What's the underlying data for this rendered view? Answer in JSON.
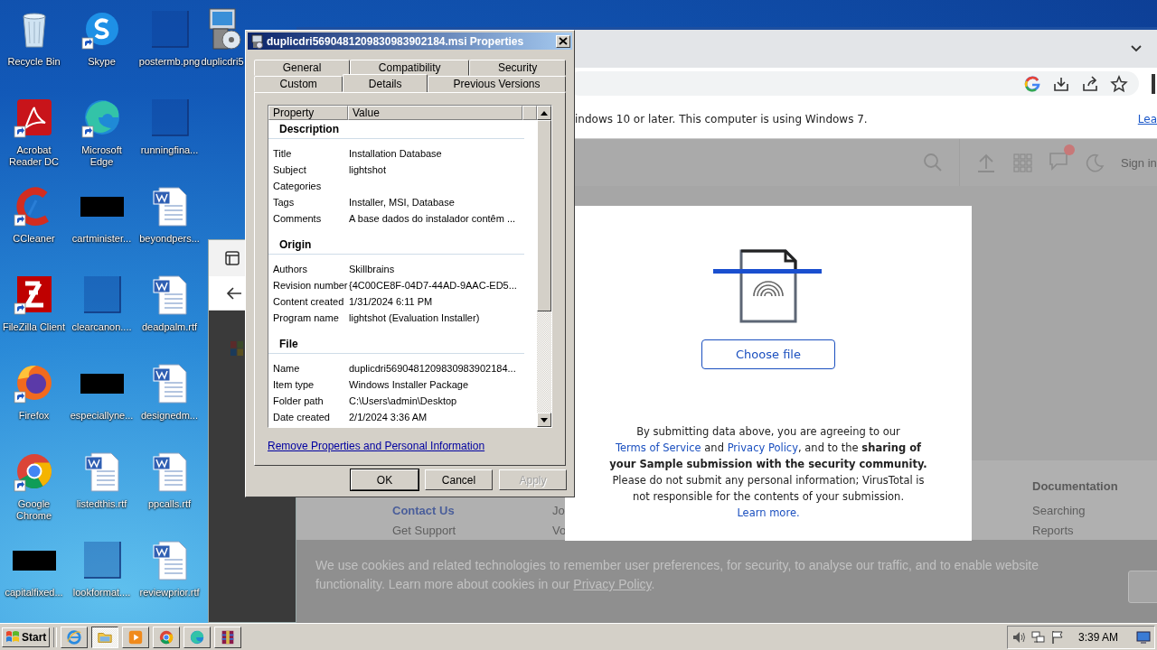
{
  "desktop_icons": [
    {
      "label": "Recycle Bin",
      "kind": "recycle",
      "shortcut": false
    },
    {
      "label": "Acrobat Reader DC",
      "kind": "acrobat",
      "shortcut": true
    },
    {
      "label": "CCleaner",
      "kind": "ccleaner",
      "shortcut": true
    },
    {
      "label": "FileZilla Client",
      "kind": "filezilla",
      "shortcut": true
    },
    {
      "label": "Firefox",
      "kind": "firefox",
      "shortcut": true
    },
    {
      "label": "Google Chrome",
      "kind": "chrome",
      "shortcut": true
    },
    {
      "label": "capitalfixed...",
      "kind": "redacted",
      "shortcut": false
    },
    {
      "label": "Skype",
      "kind": "skype",
      "shortcut": true
    },
    {
      "label": "Microsoft Edge",
      "kind": "edge",
      "shortcut": true
    },
    {
      "label": "cartminister...",
      "kind": "redacted",
      "shortcut": false
    },
    {
      "label": "clearcanon....",
      "kind": "blank",
      "shortcut": false
    },
    {
      "label": "especiallyne...",
      "kind": "redacted",
      "shortcut": false
    },
    {
      "label": "listedthis.rtf",
      "kind": "word",
      "shortcut": false
    },
    {
      "label": "lookformat....",
      "kind": "blank",
      "shortcut": false
    },
    {
      "label": "postermb.png",
      "kind": "blank",
      "shortcut": false
    },
    {
      "label": "runningfina...",
      "kind": "blank",
      "shortcut": false
    },
    {
      "label": "beyondpers...",
      "kind": "word",
      "shortcut": false
    },
    {
      "label": "deadpalm.rtf",
      "kind": "word",
      "shortcut": false
    },
    {
      "label": "designedm...",
      "kind": "word",
      "shortcut": false
    },
    {
      "label": "ppcalls.rtf",
      "kind": "word",
      "shortcut": false
    },
    {
      "label": "reviewprior.rtf",
      "kind": "word",
      "shortcut": false
    },
    {
      "label": "duplicdri5",
      "kind": "installer",
      "shortcut": false
    }
  ],
  "browser": {
    "info_bar": {
      "message": "indows 10 or later. This computer is using Windows 7.",
      "link": "Lea"
    },
    "site_header": {
      "sign_in": "Sign in"
    },
    "footer": [
      {
        "links": [
          {
            "label": "Contact Us",
            "kind": "accent"
          },
          {
            "label": "Get Support",
            "kind": "plain"
          }
        ]
      },
      {
        "links": [
          {
            "label": "Jo",
            "kind": "plain"
          },
          {
            "label": "Vo",
            "kind": "plain"
          }
        ]
      },
      {
        "heading": "Documentation",
        "links": [
          {
            "label": "Searching",
            "kind": "plain"
          },
          {
            "label": "Reports",
            "kind": "plain"
          }
        ]
      }
    ],
    "modal": {
      "button": "Choose file",
      "notice": [
        {
          "kind": "text",
          "text": "By submitting data above, you are agreeing to our "
        },
        {
          "kind": "link",
          "text": "Terms of Service"
        },
        {
          "kind": "text",
          "text": " and "
        },
        {
          "kind": "link",
          "text": "Privacy Policy"
        },
        {
          "kind": "text",
          "text": ", and to the "
        },
        {
          "kind": "bold",
          "text": "sharing of your Sample submission with the security community."
        },
        {
          "kind": "text",
          "text": " Please do not submit any personal information; VirusTotal is not responsible for the contents of your submission. "
        },
        {
          "kind": "link",
          "text": "Learn more."
        }
      ]
    },
    "cookie_banner": [
      {
        "kind": "text",
        "text": "We use cookies and related technologies to remember user preferences, for security, to analyse our traffic, and to enable website functionality. Learn more about cookies in our "
      },
      {
        "kind": "link",
        "text": "Privacy Policy"
      },
      {
        "kind": "text",
        "text": "."
      }
    ]
  },
  "properties_dialog": {
    "title": "duplicdri5690481209830983902184.msi Properties",
    "tab_rows": [
      [
        {
          "label": "General",
          "selected": false
        },
        {
          "label": "Compatibility",
          "selected": false
        },
        {
          "label": "Security",
          "selected": false
        }
      ],
      [
        {
          "label": "Custom",
          "selected": false
        },
        {
          "label": "Details",
          "selected": true
        },
        {
          "label": "Previous Versions",
          "selected": false
        }
      ]
    ],
    "columns": [
      "Property",
      "Value"
    ],
    "groups": [
      {
        "heading": "Description",
        "rows": [
          {
            "property": "Title",
            "value": "Installation Database"
          },
          {
            "property": "Subject",
            "value": "lightshot"
          },
          {
            "property": "Categories"
          },
          {
            "property": "Tags",
            "value": "Installer, MSI, Database"
          },
          {
            "property": "Comments",
            "value": "A base dados do instalador contêm ..."
          }
        ]
      },
      {
        "heading": "Origin",
        "rows": [
          {
            "property": "Authors",
            "value": "Skillbrains"
          },
          {
            "property": "Revision number",
            "value": "{4C00CE8F-04D7-44AD-9AAC-ED5..."
          },
          {
            "property": "Content created",
            "value": "1/31/2024 6:11 PM"
          },
          {
            "property": "Program name",
            "value": "lightshot (Evaluation Installer)"
          }
        ]
      },
      {
        "heading": "File",
        "rows": [
          {
            "property": "Name",
            "value": "duplicdri5690481209830983902184..."
          },
          {
            "property": "Item type",
            "value": "Windows Installer Package"
          },
          {
            "property": "Folder path",
            "value": "C:\\Users\\admin\\Desktop"
          },
          {
            "property": "Date created",
            "value": "2/1/2024 3:36 AM"
          }
        ]
      }
    ],
    "link": "Remove Properties and Personal Information",
    "buttons": [
      {
        "label": "OK",
        "default": true,
        "disabled": false
      },
      {
        "label": "Cancel",
        "default": false,
        "disabled": false
      },
      {
        "label": "Apply",
        "default": false,
        "disabled": true
      }
    ]
  },
  "taskbar": {
    "start": "Start",
    "apps": [
      {
        "kind": "ie",
        "selected": false
      },
      {
        "kind": "explorer",
        "selected": true
      },
      {
        "kind": "media",
        "selected": false
      },
      {
        "kind": "chrome",
        "selected": false
      },
      {
        "kind": "edge",
        "selected": false
      },
      {
        "kind": "archive",
        "selected": false
      }
    ],
    "clock": "3:39 AM"
  }
}
